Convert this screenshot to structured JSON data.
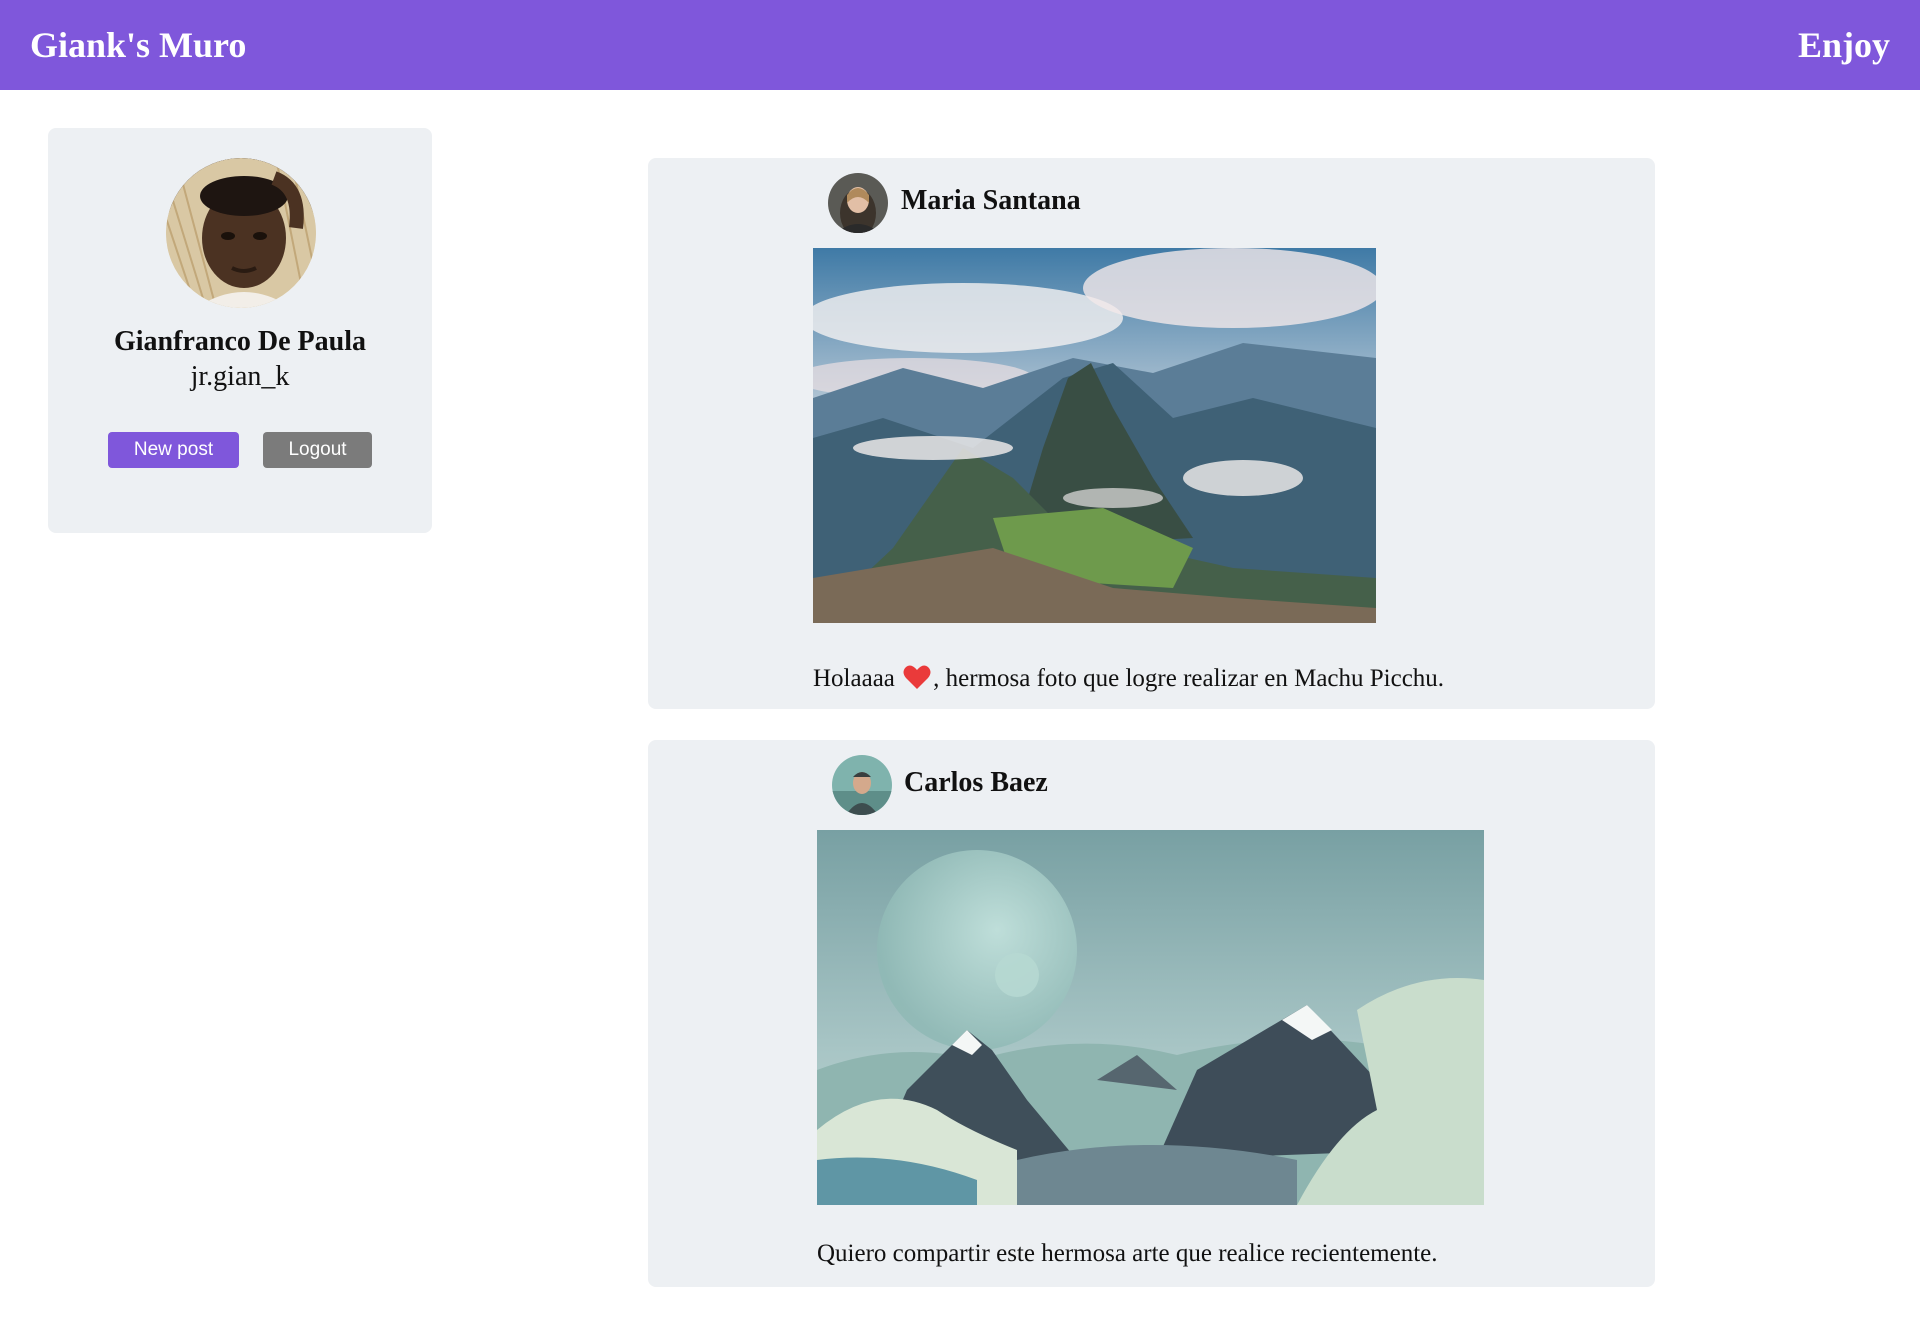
{
  "header": {
    "brand": "Giank's Muro",
    "right_text": "Enjoy",
    "color": "#7f57db"
  },
  "profile": {
    "name": "Gianfranco De Paula",
    "handle": "jr.gian_k",
    "avatar_icon": "user-photo",
    "buttons": {
      "new_post": "New post",
      "logout": "Logout"
    },
    "colors": {
      "new_post": "#7f57db",
      "logout": "#7b7b7b"
    }
  },
  "posts": [
    {
      "author": "Maria Santana",
      "avatar_icon": "user-photo",
      "image_icon": "machu-picchu-photo",
      "caption_before": "Holaaaa",
      "caption_icon": "heart-icon",
      "caption_after": ", hermosa foto que logre realizar en Machu Picchu."
    },
    {
      "author": "Carlos Baez",
      "avatar_icon": "user-photo",
      "image_icon": "mountains-art",
      "caption": "Quiero compartir este hermosa arte que realice recientemente."
    }
  ]
}
